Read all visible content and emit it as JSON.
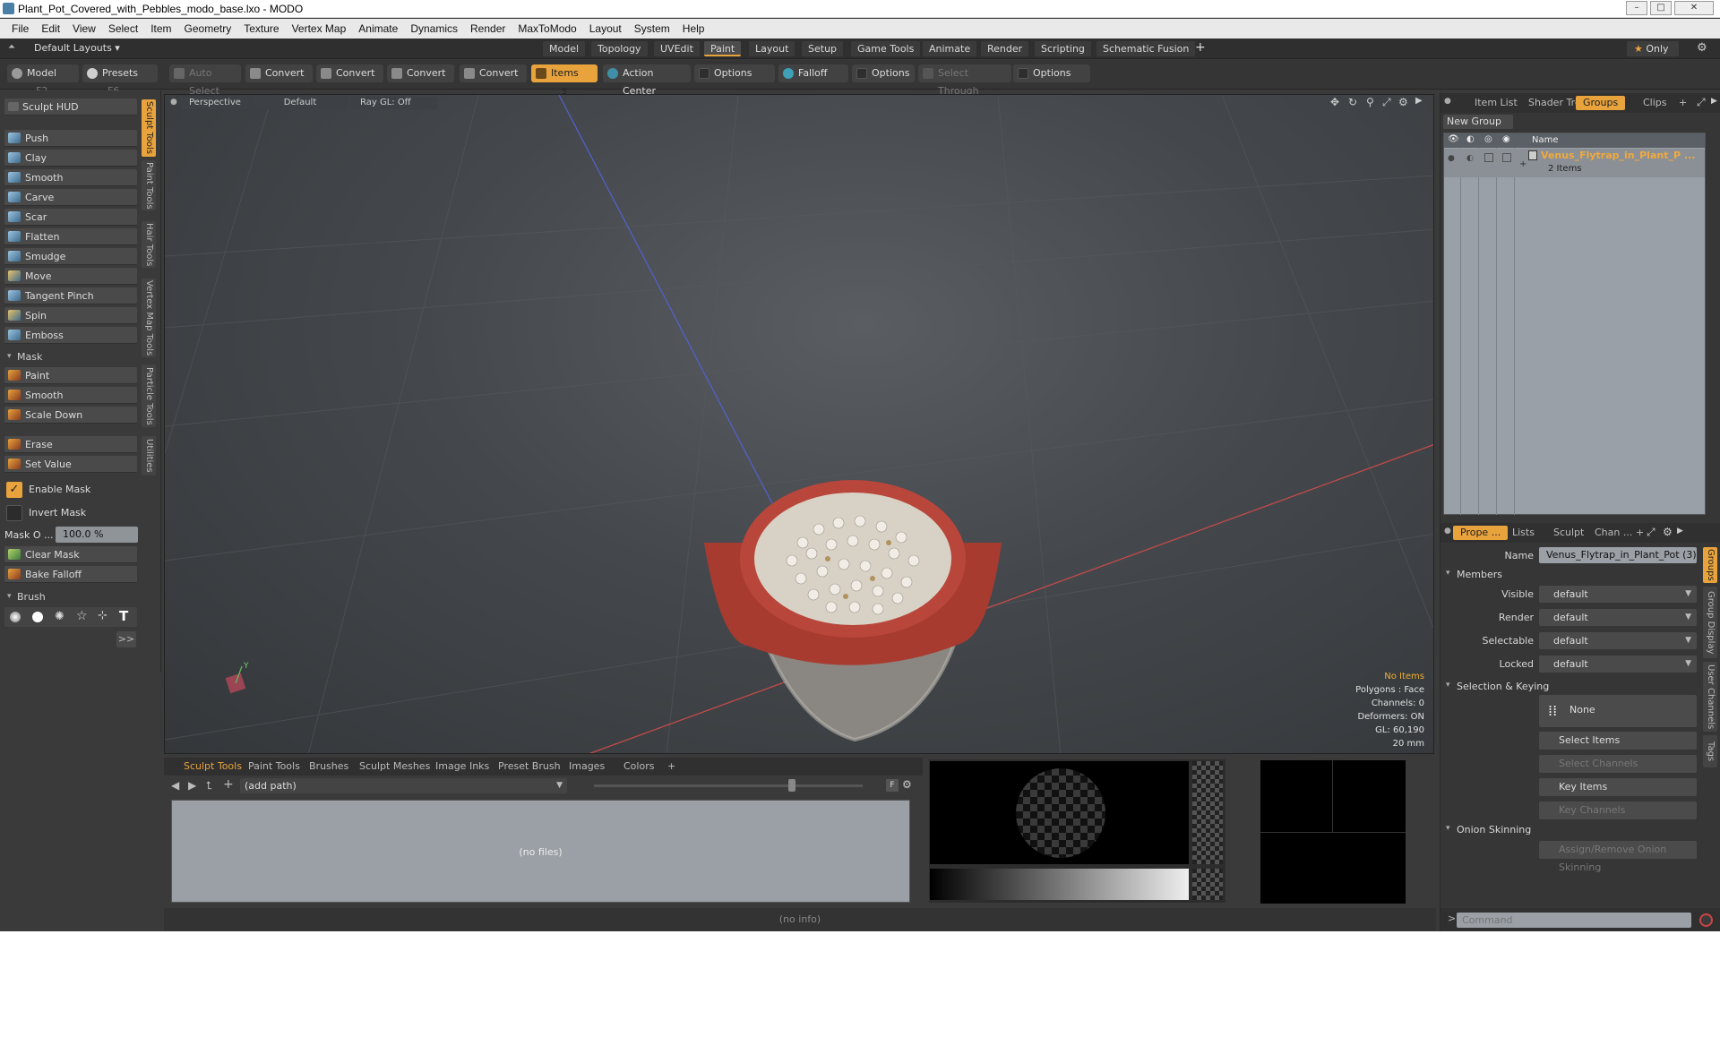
{
  "window": {
    "title": "Plant_Pot_Covered_with_Pebbles_modo_base.lxo - MODO",
    "controls": [
      "–",
      "□",
      "✕"
    ]
  },
  "menu": [
    "File",
    "Edit",
    "View",
    "Select",
    "Item",
    "Geometry",
    "Texture",
    "Vertex Map",
    "Animate",
    "Dynamics",
    "Render",
    "MaxToModo",
    "Layout",
    "System",
    "Help"
  ],
  "layoutbar": {
    "layouts_label": "Default Layouts ▾",
    "tabs": [
      "Model",
      "Topology",
      "UVEdit",
      "Paint",
      "Layout",
      "Setup",
      "Game Tools",
      "Animate",
      "Render",
      "Scripting",
      "Schematic Fusion"
    ],
    "active_tab": "Paint",
    "add": "+",
    "only": "Only",
    "only_star": "★"
  },
  "toolbar": {
    "model": "Model",
    "model_key": "F2",
    "presets": "Presets",
    "presets_key": "F6",
    "auto_select": "Auto Select",
    "convert1": "Convert",
    "convert2": "Convert",
    "convert3": "Convert",
    "convert4": "Convert",
    "items": "Items",
    "items_key": "5",
    "action_center": "Action Center",
    "options1": "Options",
    "falloff": "Falloff",
    "options2": "Options",
    "select_through": "Select Through",
    "options3": "Options"
  },
  "left": {
    "sculpt_hud": "Sculpt HUD",
    "tools": [
      "Push",
      "Clay",
      "Smooth",
      "Carve",
      "Scar",
      "Flatten",
      "Smudge",
      "Move",
      "Tangent Pinch",
      "Spin",
      "Emboss"
    ],
    "mask_section": "Mask",
    "mask_tools": [
      "Paint",
      "Smooth",
      "Scale Down"
    ],
    "erase": "Erase",
    "set_value": "Set Value",
    "enable_mask": "Enable Mask",
    "invert_mask": "Invert Mask",
    "mask_opacity_label": "Mask O ...",
    "mask_opacity_value": "100.0 %",
    "clear_mask": "Clear Mask",
    "bake_falloff": "Bake Falloff",
    "brush_section": "Brush",
    "more": ">>",
    "vtabs": [
      "Sculpt Tools",
      "Paint Tools",
      "Hair Tools",
      "Vertex Map Tools",
      "Particle Tools",
      "Utilities"
    ]
  },
  "viewport": {
    "view": "Perspective",
    "shading": "Default",
    "raygl": "Ray GL: Off",
    "info": [
      "No Items",
      "Polygons : Face",
      "Channels: 0",
      "Deformers: ON",
      "GL: 60,190",
      "20 mm"
    ],
    "axis_y": "Y"
  },
  "bottom": {
    "tabs": [
      "Sculpt Tools",
      "Paint Tools",
      "Brushes",
      "Sculpt Meshes",
      "Image Inks",
      "Preset Brush",
      "Images",
      "Colors",
      "+"
    ],
    "path": "(add path)",
    "no_files": "(no files)",
    "f_label": "F",
    "status": "(no info)"
  },
  "right": {
    "top_tabs": [
      "Item List",
      "Shader Tree",
      "Groups",
      "Clips",
      "+"
    ],
    "new_group": "New Group",
    "col_name": "Name",
    "group_name": "Venus_Flytrap_in_Plant_P ...",
    "group_count": "2 Items",
    "prop_tabs": [
      "Prope ...",
      "Lists",
      "Sculpt",
      "Chan ...",
      "+"
    ],
    "name_label": "Name",
    "name_value": "Venus_Flytrap_in_Plant_Pot (3)",
    "members": "Members",
    "visible_label": "Visible",
    "render_label": "Render",
    "selectable_label": "Selectable",
    "locked_label": "Locked",
    "default_value": "default",
    "selkey": "Selection & Keying",
    "none": "None",
    "select_items": "Select Items",
    "select_channels": "Select Channels",
    "key_items": "Key Items",
    "key_channels": "Key Channels",
    "onion": "Onion Skinning",
    "assign_onion": "Assign/Remove Onion Skinning",
    "command_prompt": ">",
    "command_placeholder": "Command",
    "side_tabs": [
      "Groups",
      "Group Display",
      "User Channels",
      "Tags"
    ]
  },
  "colors": {
    "accent": "#e8a33d",
    "group_text": "#f2a93b"
  }
}
